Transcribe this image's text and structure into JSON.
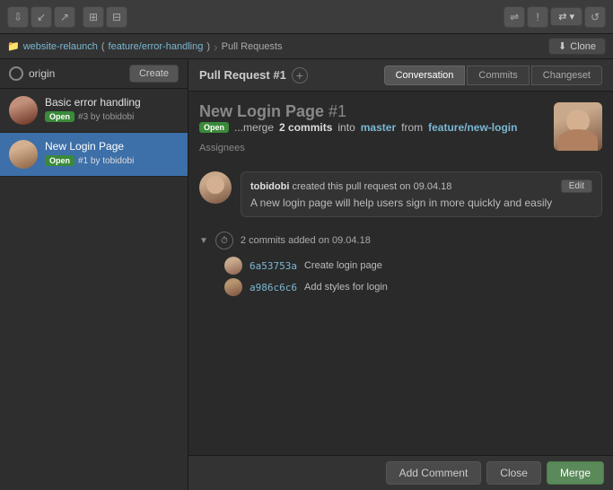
{
  "toolbar": {
    "buttons": [
      {
        "id": "fetch",
        "label": "↙",
        "icon": "fetch-icon"
      },
      {
        "id": "pull",
        "label": "↓",
        "icon": "pull-icon"
      },
      {
        "id": "push",
        "label": "↑",
        "icon": "push-icon"
      },
      {
        "id": "branch",
        "label": "⎇",
        "icon": "branch-icon"
      },
      {
        "id": "stash",
        "label": "⌂",
        "icon": "stash-icon"
      },
      {
        "id": "discard",
        "label": "↺",
        "icon": "discard-icon"
      },
      {
        "id": "terminal",
        "label": "⌘",
        "icon": "terminal-icon"
      },
      {
        "id": "settings",
        "label": "⚙",
        "icon": "settings-icon"
      }
    ]
  },
  "breadcrumb": {
    "repo": "website-relaunch",
    "branch": "feature/error-handling",
    "section": "Pull Requests",
    "clone_label": "Clone"
  },
  "sidebar": {
    "origin_label": "origin",
    "create_label": "Create",
    "items": [
      {
        "title": "Basic error handling",
        "status": "Open",
        "number": "#3",
        "author": "tobidobi",
        "selected": false
      },
      {
        "title": "New Login Page",
        "status": "Open",
        "number": "#1",
        "author": "tobidobi",
        "selected": true
      }
    ]
  },
  "pull_request": {
    "header_label": "Pull Request #1",
    "title": "New Login Page",
    "number": "#1",
    "status": "Open",
    "description": "...merge",
    "commits_count": "2 commits",
    "target_branch": "master",
    "source_branch": "feature/new-login",
    "tabs": [
      {
        "label": "Conversation",
        "active": true
      },
      {
        "label": "Commits",
        "active": false
      },
      {
        "label": "Changeset",
        "active": false
      }
    ],
    "assignees_label": "Assignees",
    "conversation": {
      "author": "tobidobi",
      "action": "created this pull request on",
      "date": "09.04.18",
      "edit_label": "Edit",
      "message": "A new login page will help users sign in more quickly and easily"
    },
    "commits_section": {
      "label": "2 commits added on 09.04.18",
      "commits": [
        {
          "hash": "6a53753a",
          "message": "Create login page"
        },
        {
          "hash": "a986c6c6",
          "message": "Add styles for login"
        }
      ]
    }
  },
  "bottom_bar": {
    "add_comment_label": "Add Comment",
    "close_label": "Close",
    "merge_label": "Merge"
  }
}
